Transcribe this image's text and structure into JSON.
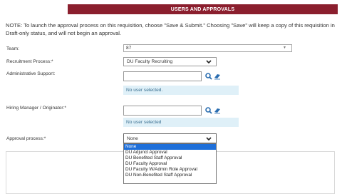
{
  "header": {
    "title": "USERS AND APPROVALS"
  },
  "note": "NOTE: To launch the approval process on this requisition, choose \"Save & Submit.\" Choosing \"Save\" will keep a copy of this requisition in Draft-only status, and will not begin an approval.",
  "team": {
    "label": "Team:",
    "value": "87"
  },
  "recruitment_process": {
    "label": "Recruitment Process:*",
    "value": "DU Faculty Recruiting"
  },
  "administrative_support": {
    "label": "Administrative Support:",
    "value": "",
    "empty_text": "No user selected."
  },
  "hiring_manager": {
    "label": "Hiring Manager / Originator:*",
    "value": "",
    "empty_text": "No user selected"
  },
  "approval_process": {
    "label": "Approval process:*",
    "value": "None",
    "options": [
      "None",
      "DU Adjunct Approval",
      "DU Benefited Staff Approval",
      "DU Faculty Approval",
      "DU Faculty W/Admin Role Approval",
      "DU Non-Benefited Staff Approval"
    ],
    "selected_index": 0
  },
  "icons": {
    "search": "search-icon",
    "clear": "eraser-icon",
    "dropdown": "chevron-down-icon"
  },
  "colors": {
    "banner": "#8b1f2e",
    "selection": "#1e6fd9",
    "empty_strip": "#dff0f8",
    "icon_blue": "#2a6db0"
  }
}
